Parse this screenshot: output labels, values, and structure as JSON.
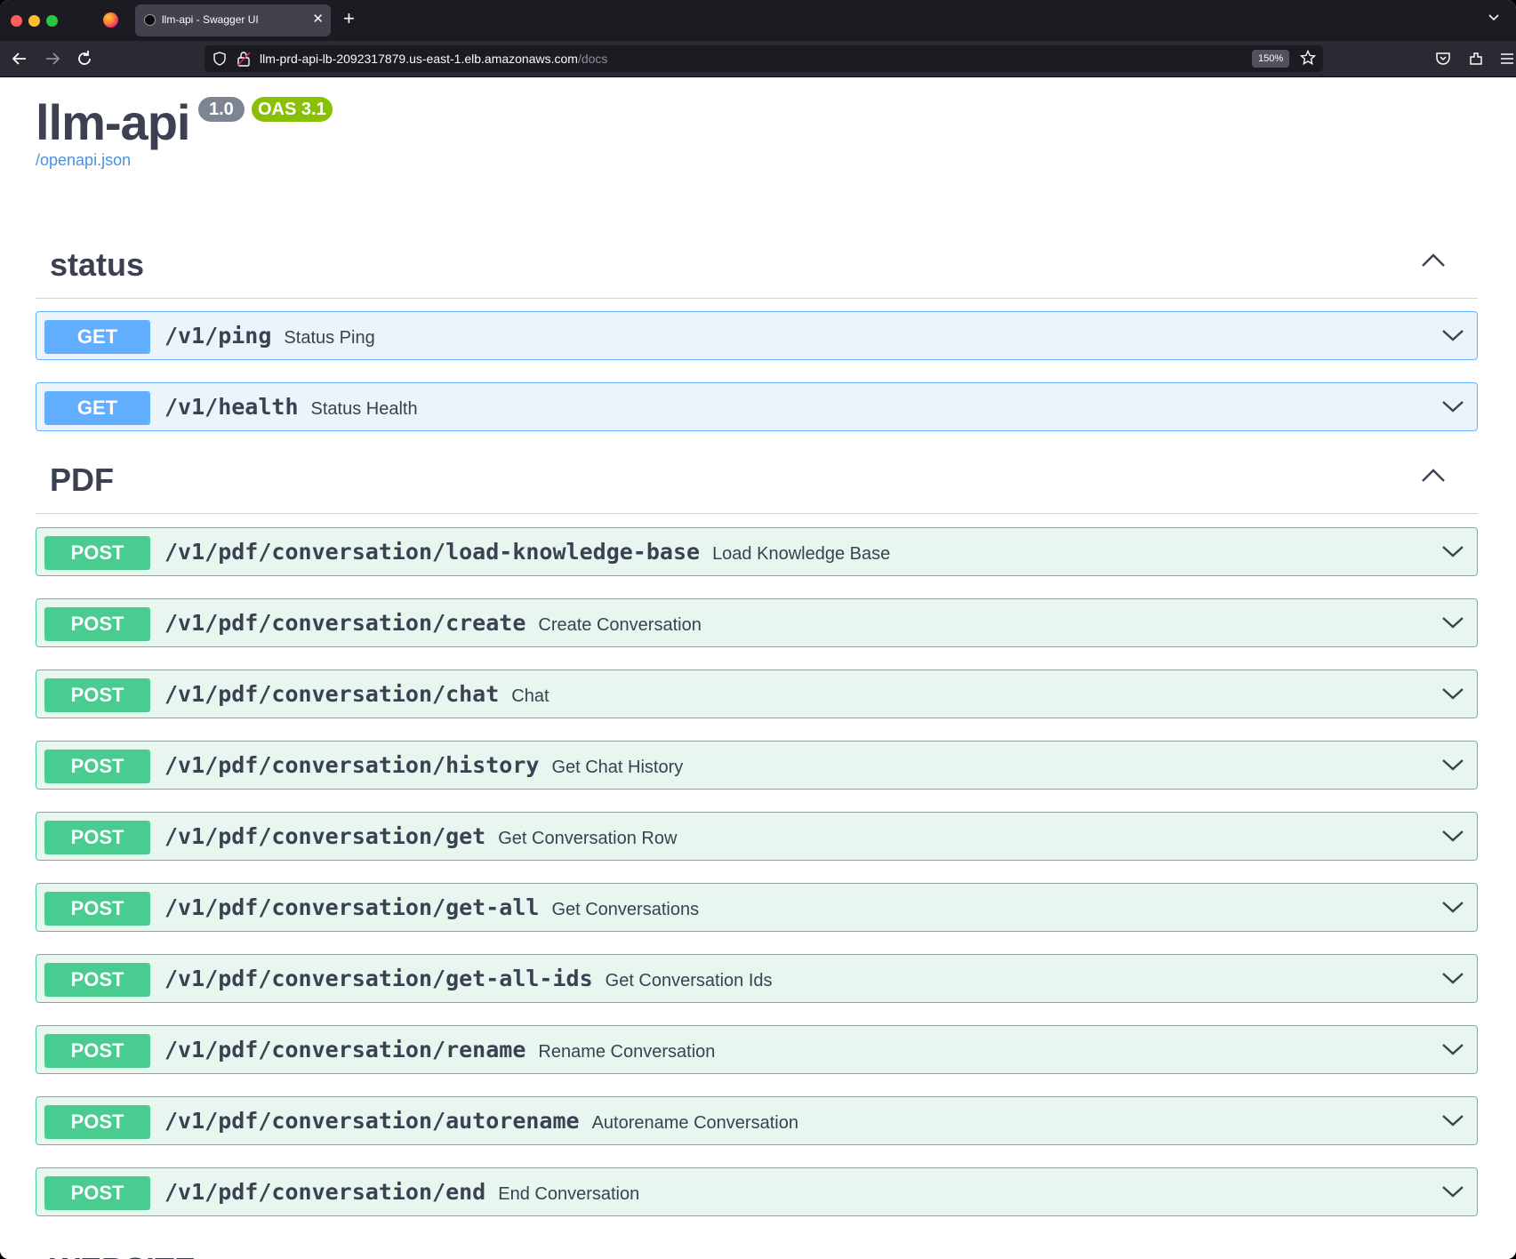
{
  "browser": {
    "tab_title": "llm-api - Swagger UI",
    "tab_close": "✕",
    "new_tab": "+",
    "url_host": "llm-prd-api-lb-2092317879.us-east-1.elb.amazonaws.com",
    "url_path": "/docs",
    "zoom": "150%"
  },
  "info": {
    "title": "llm-api",
    "version": "1.0",
    "oas": "OAS 3.1",
    "spec_link": "/openapi.json"
  },
  "sections": [
    {
      "name": "status",
      "operations": [
        {
          "method": "GET",
          "path": "/v1/ping",
          "summary": "Status Ping"
        },
        {
          "method": "GET",
          "path": "/v1/health",
          "summary": "Status Health"
        }
      ]
    },
    {
      "name": "PDF",
      "operations": [
        {
          "method": "POST",
          "path": "/v1/pdf/conversation/load-knowledge-base",
          "summary": "Load Knowledge Base"
        },
        {
          "method": "POST",
          "path": "/v1/pdf/conversation/create",
          "summary": "Create Conversation"
        },
        {
          "method": "POST",
          "path": "/v1/pdf/conversation/chat",
          "summary": "Chat"
        },
        {
          "method": "POST",
          "path": "/v1/pdf/conversation/history",
          "summary": "Get Chat History"
        },
        {
          "method": "POST",
          "path": "/v1/pdf/conversation/get",
          "summary": "Get Conversation Row"
        },
        {
          "method": "POST",
          "path": "/v1/pdf/conversation/get-all",
          "summary": "Get Conversations"
        },
        {
          "method": "POST",
          "path": "/v1/pdf/conversation/get-all-ids",
          "summary": "Get Conversation Ids"
        },
        {
          "method": "POST",
          "path": "/v1/pdf/conversation/rename",
          "summary": "Rename Conversation"
        },
        {
          "method": "POST",
          "path": "/v1/pdf/conversation/autorename",
          "summary": "Autorename Conversation"
        },
        {
          "method": "POST",
          "path": "/v1/pdf/conversation/end",
          "summary": "End Conversation"
        }
      ]
    },
    {
      "name": "WEBSITE",
      "operations": []
    }
  ],
  "colors": {
    "get": "#61affe",
    "post": "#49cc90",
    "text": "#3b4151",
    "link": "#4990e2",
    "oas_badge": "#89bf04",
    "version_badge": "#7d8492"
  }
}
